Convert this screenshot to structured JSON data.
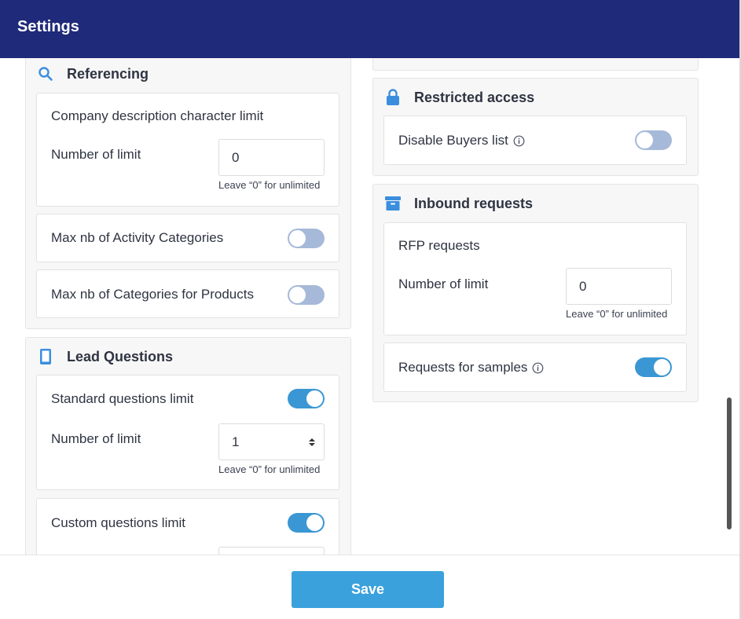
{
  "header": {
    "title": "Settings"
  },
  "referencing": {
    "title": "Referencing",
    "company_description": {
      "label": "Company description character limit",
      "limit_label": "Number of limit",
      "value": "0",
      "hint": "Leave “0” for unlimited"
    },
    "max_activity_categories": {
      "label": "Max nb of Activity Categories",
      "enabled": false
    },
    "max_product_categories": {
      "label": "Max nb of Categories for Products",
      "enabled": false
    }
  },
  "lead_questions": {
    "title": "Lead Questions",
    "standard": {
      "label": "Standard questions limit",
      "enabled": true,
      "limit_label": "Number of limit",
      "value": "1",
      "hint": "Leave “0” for unlimited"
    },
    "custom": {
      "label": "Custom questions limit",
      "enabled": true
    }
  },
  "restricted_access": {
    "title": "Restricted access",
    "disable_buyers": {
      "label": "Disable Buyers list",
      "enabled": false
    }
  },
  "inbound_requests": {
    "title": "Inbound requests",
    "rfp": {
      "label": "RFP requests",
      "limit_label": "Number of limit",
      "value": "0",
      "hint": "Leave “0” for unlimited"
    },
    "samples": {
      "label": "Requests for samples",
      "enabled": true
    }
  },
  "footer": {
    "save_label": "Save"
  },
  "colors": {
    "header_bg": "#1f2a7a",
    "accent": "#3ba1dc",
    "toggle_on": "#3b97d3",
    "toggle_off": "#a6b9d9"
  }
}
